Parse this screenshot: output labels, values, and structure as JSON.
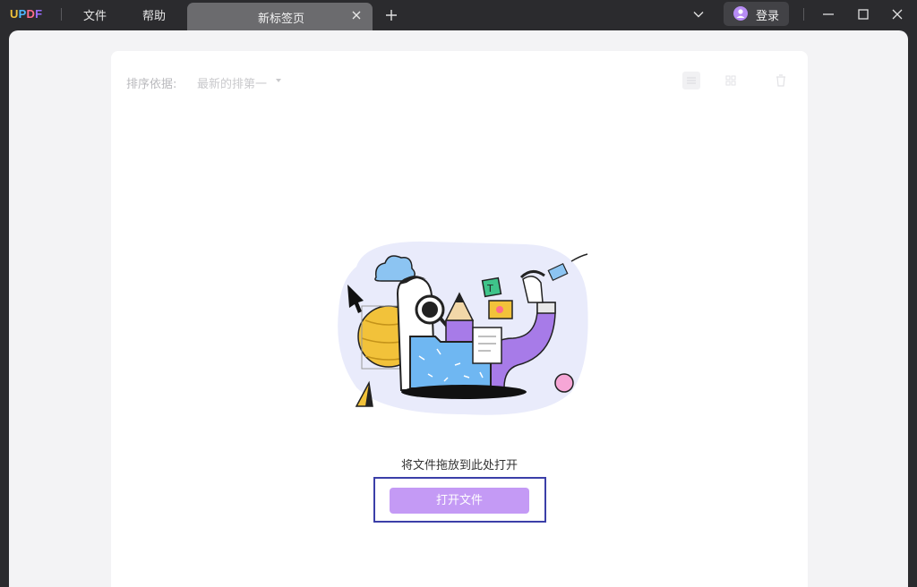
{
  "app": {
    "logo": "UPDF",
    "menu": [
      "文件",
      "帮助"
    ]
  },
  "tabs": [
    {
      "label": "新标签页",
      "active": true
    }
  ],
  "account": {
    "login_label": "登录"
  },
  "toolbar": {
    "sort_label": "排序依据:",
    "sort_value": "最新的排第一"
  },
  "dropzone": {
    "hint": "将文件拖放到此处打开",
    "open_button": "打开文件"
  },
  "colors": {
    "titlebar_bg": "#2b2b2e",
    "accent_button": "#c49af5",
    "highlight_frame": "#3b3fa8"
  }
}
